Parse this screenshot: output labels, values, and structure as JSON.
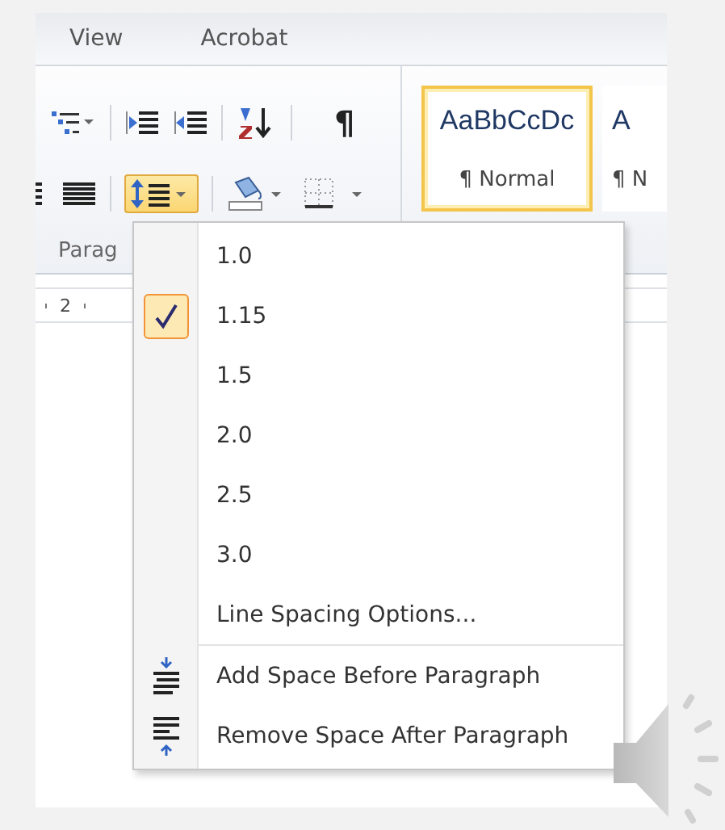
{
  "tabs": [
    {
      "label": "View",
      "selected": false
    },
    {
      "label": "Acrobat",
      "selected": false
    }
  ],
  "ribbon": {
    "pilcrow": "¶",
    "line_spacing_open": true,
    "group_label": "Parag",
    "styles": [
      {
        "sample": "AaBbCcDc",
        "name": "¶ Normal",
        "selected": true
      },
      {
        "sample": "A",
        "name": "¶ N",
        "selected": false
      }
    ]
  },
  "ruler": {
    "mark": "2"
  },
  "menu": [
    {
      "kind": "spacing",
      "label": "1.0",
      "checked": false
    },
    {
      "kind": "spacing",
      "label": "1.15",
      "checked": true
    },
    {
      "kind": "spacing",
      "label": "1.5",
      "checked": false
    },
    {
      "kind": "spacing",
      "label": "2.0",
      "checked": false
    },
    {
      "kind": "spacing",
      "label": "2.5",
      "checked": false
    },
    {
      "kind": "spacing",
      "label": "3.0",
      "checked": false
    },
    {
      "kind": "dialog",
      "label": "Line Spacing Options..."
    },
    {
      "kind": "before",
      "label": "Add Space Before Paragraph"
    },
    {
      "kind": "after",
      "label": "Remove Space After Paragraph"
    }
  ]
}
